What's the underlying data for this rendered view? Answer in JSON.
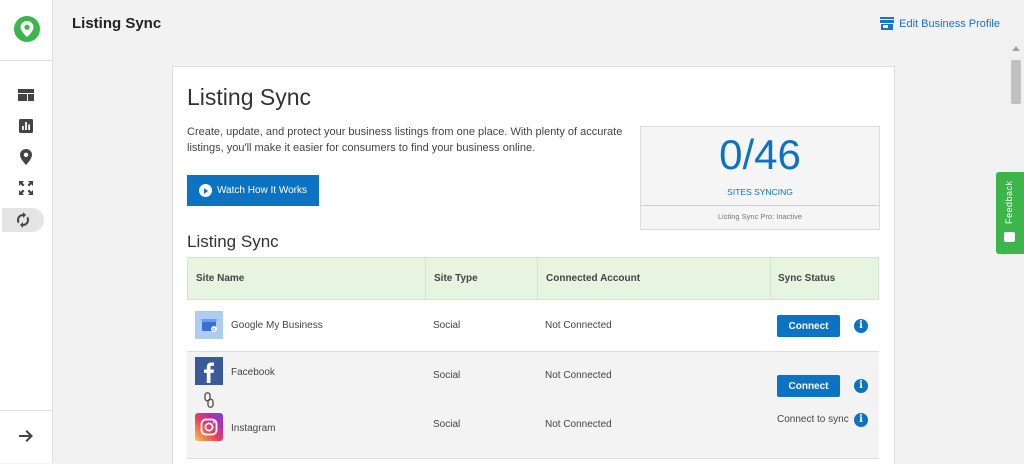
{
  "header": {
    "title": "Listing Sync",
    "edit_profile_label": "Edit Business Profile"
  },
  "feedback_label": "Feedback",
  "card": {
    "title": "Listing Sync",
    "description": "Create, update, and protect your business listings from one place. With plenty of accurate listings, you'll make it easier for consumers to find your business online.",
    "watch_button_label": "Watch How It Works",
    "sync": {
      "count": "0/46",
      "caption": "SITES SYNCING",
      "pro_status": "Listing Sync Pro: Inactive"
    },
    "section_title": "Listing Sync"
  },
  "table": {
    "headers": [
      "Site Name",
      "Site Type",
      "Connected Account",
      "Sync Status"
    ],
    "rows": [
      {
        "site": "Google My Business",
        "type": "Social",
        "account": "Not Connected",
        "status_button": "Connect"
      },
      {
        "site": "Facebook",
        "type": "Social",
        "account": "Not Connected",
        "status_button": "Connect"
      },
      {
        "site": "Instagram",
        "type": "Social",
        "account": "Not Connected",
        "status_text": "Connect to sync"
      }
    ]
  },
  "colors": {
    "brand_green": "#3cb54a",
    "accent_blue": "#0b73c2",
    "header_green": "#e6f4e1"
  },
  "icons": {
    "sidebar": [
      "dashboard-icon",
      "bar-chart-icon",
      "location-pin-icon",
      "expand-icon",
      "sync-icon"
    ],
    "footer": "arrow-right-icon"
  }
}
